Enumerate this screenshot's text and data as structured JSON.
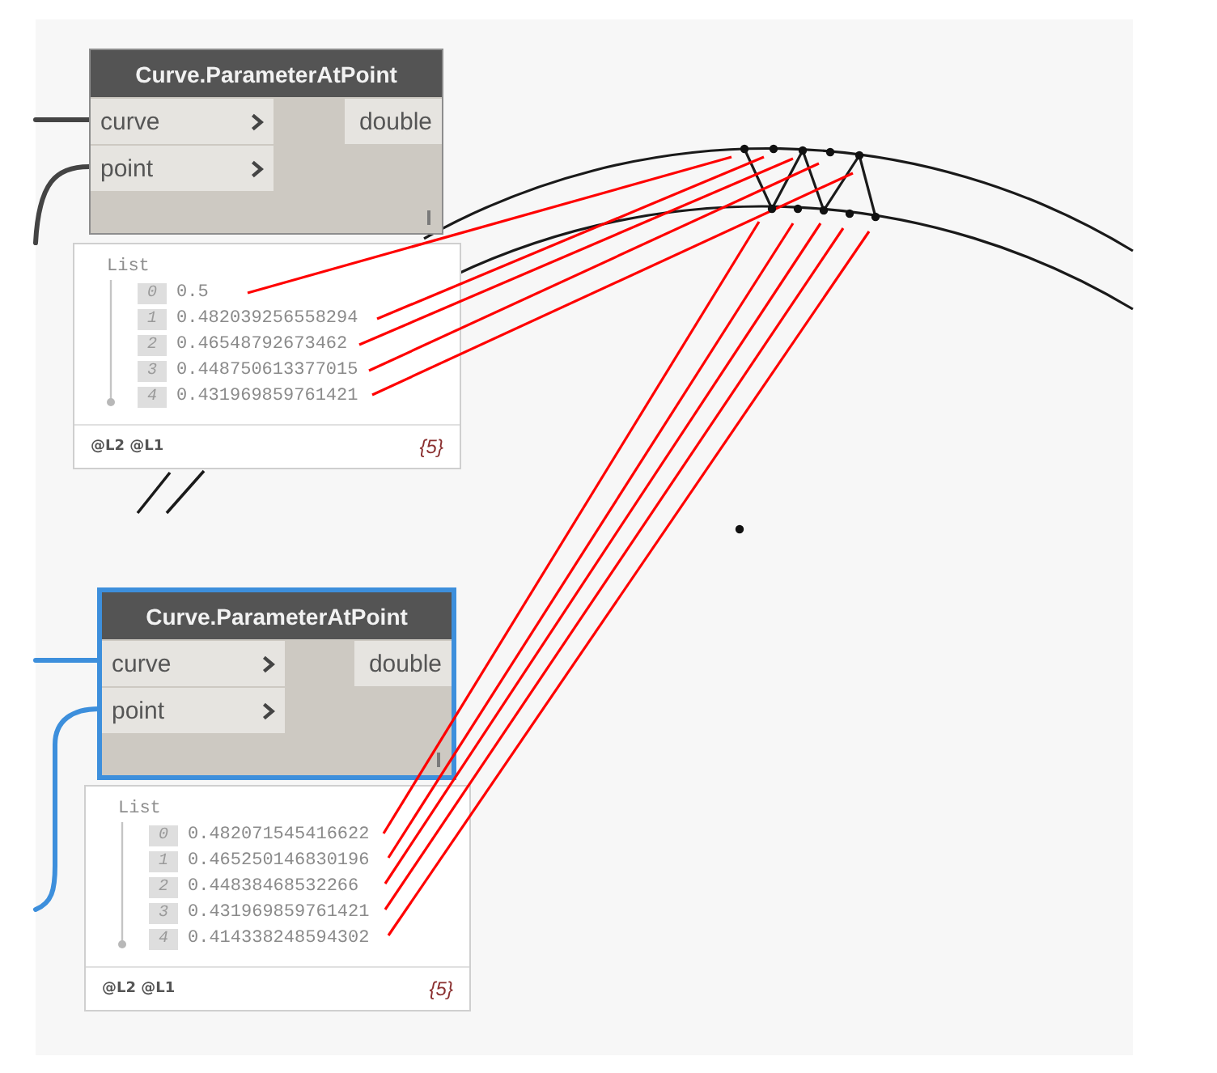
{
  "nodes": [
    {
      "title": "Curve.ParameterAtPoint",
      "selected": false,
      "inputs": [
        "curve",
        "point"
      ],
      "outputs": [
        "double"
      ],
      "preview": {
        "label": "List",
        "items": [
          {
            "index": "0",
            "value": "0.5"
          },
          {
            "index": "1",
            "value": "0.482039256558294"
          },
          {
            "index": "2",
            "value": "0.46548792673462"
          },
          {
            "index": "3",
            "value": "0.448750613377015"
          },
          {
            "index": "4",
            "value": "0.431969859761421"
          }
        ],
        "levels": "@L2 @L1",
        "count": "{5}"
      }
    },
    {
      "title": "Curve.ParameterAtPoint",
      "selected": true,
      "inputs": [
        "curve",
        "point"
      ],
      "outputs": [
        "double"
      ],
      "preview": {
        "label": "List",
        "items": [
          {
            "index": "0",
            "value": "0.482071545416622"
          },
          {
            "index": "1",
            "value": "0.465250146830196"
          },
          {
            "index": "2",
            "value": "0.44838468532266"
          },
          {
            "index": "3",
            "value": "0.431969859761421"
          },
          {
            "index": "4",
            "value": "0.414338248594302"
          }
        ],
        "levels": "@L2 @L1",
        "count": "{5}"
      }
    }
  ]
}
